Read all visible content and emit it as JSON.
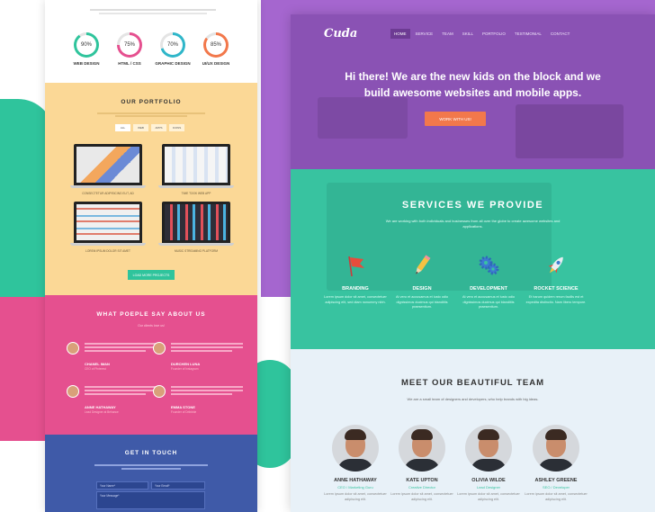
{
  "left": {
    "skills": {
      "items": [
        {
          "percent": "90%",
          "label": "WEB DESIGN",
          "color": "#2fc49c",
          "level": 0.9
        },
        {
          "percent": "75%",
          "label": "HTML / CSS",
          "color": "#e5508f",
          "level": 0.75
        },
        {
          "percent": "70%",
          "label": "GRAPHIC DESIGN",
          "color": "#2fb6c9",
          "level": 0.7
        },
        {
          "percent": "85%",
          "label": "UI/UX DESIGN",
          "color": "#f2784b",
          "level": 0.85
        }
      ]
    },
    "portfolio": {
      "title": "OUR PORTFOLIO",
      "filters": [
        "ALL",
        "WEB",
        "APPS",
        "ICONS"
      ],
      "items": [
        {
          "caption": "CONSECTETUR ADIPISICING ELIT, AD"
        },
        {
          "caption": "TIME TOOK WEB APP"
        },
        {
          "caption": "LOREM IPSUM DOLOR SIT AMET"
        },
        {
          "caption": "MUSIC STREAMING PLATFORM"
        }
      ],
      "load_button": "LOAD MORE PROJECTS"
    },
    "testimonials": {
      "title": "WHAT POEPLE SAY ABOUT US",
      "subtitle": "Our clients love us!",
      "items": [
        {
          "name": "CHANEL IMAN",
          "role": "CEO of Pinterest"
        },
        {
          "name": "DURCHEN LUNA",
          "role": "Founder of Instagram"
        },
        {
          "name": "ANNE HATHAWAY",
          "role": "Lead Designer at Behance"
        },
        {
          "name": "EMMA STONE",
          "role": "Founder of Dribbble"
        }
      ]
    },
    "contact": {
      "title": "GET IN TOUCH",
      "name_placeholder": "Your Name*",
      "email_placeholder": "Your Email*",
      "message_placeholder": "Your Message*"
    }
  },
  "right": {
    "logo": "Cuda",
    "nav": [
      "HOME",
      "SERVICE",
      "TEAM",
      "SKILL",
      "PORTFOLIO",
      "TESTIMONIAL",
      "CONTACT"
    ],
    "hero": {
      "title_line1": "Hi there! We are the new kids on the block and we",
      "title_line2": "build awesome websites and mobile apps.",
      "button": "WORK WITH US!"
    },
    "services": {
      "title": "SERVICES WE PROVIDE",
      "subtitle": "We are working with both individuals and businesses from all over the globe to create awesome websites and applications.",
      "items": [
        {
          "name": "BRANDING",
          "text": "Lorem ipsum dolor sit amet, consectetuer adipiscing elit, sed diam nonummy nibh.",
          "icon": "flag-icon"
        },
        {
          "name": "DESIGN",
          "text": "At vero et accusamus et iusto odio dignissimos ducimus qui blanditiis praesentium.",
          "icon": "pencil-icon"
        },
        {
          "name": "DEVELOPMENT",
          "text": "At vero et accusamus et iusto odio dignissimos ducimus qui blanditiis praesentium.",
          "icon": "gears-icon"
        },
        {
          "name": "ROCKET SCIENCE",
          "text": "Et harum quidem rerum facilis est et expedita distinctio. Nam libero tempore.",
          "icon": "rocket-icon"
        }
      ]
    },
    "team": {
      "title": "MEET OUR BEAUTIFUL TEAM",
      "subtitle": "We are a small team of designers and developers, who help brands with big ideas.",
      "members": [
        {
          "name": "ANNE HATHAWAY",
          "role": "CEO / Marketing Guru"
        },
        {
          "name": "KATE UPTON",
          "role": "Creative Director"
        },
        {
          "name": "OLIVIA WILDE",
          "role": "Lead Designer"
        },
        {
          "name": "ASHLEY GREENE",
          "role": "SEO / Developer"
        }
      ],
      "member_text": "Lorem ipsum dolor sit amet, consectetuer adipiscing elit."
    }
  }
}
